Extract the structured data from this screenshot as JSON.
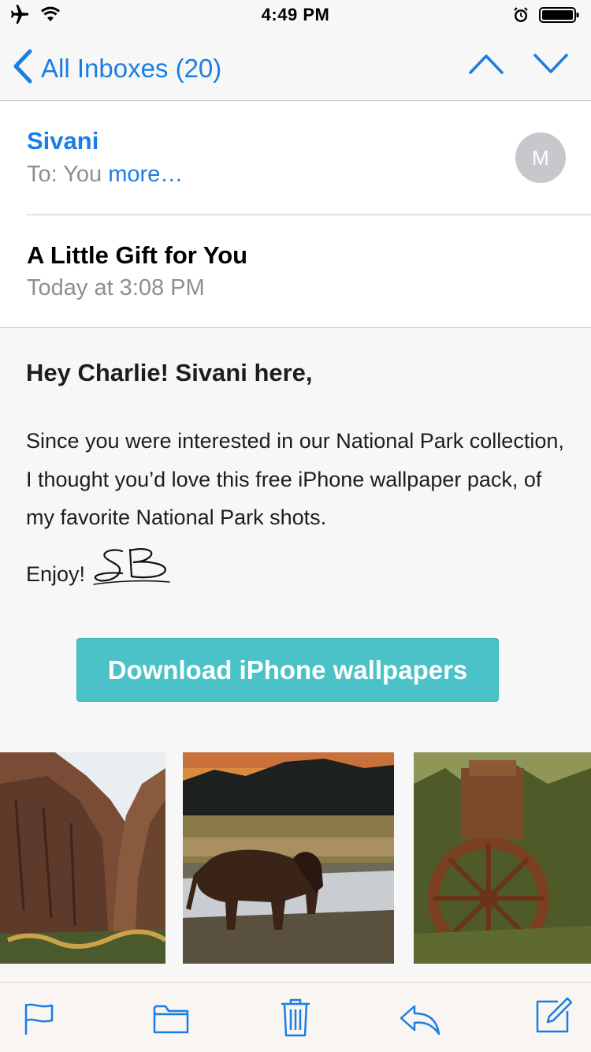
{
  "status_bar": {
    "time": "4:49 PM",
    "icons": [
      "airplane-icon",
      "wifi-icon",
      "alarm-icon",
      "battery-icon"
    ]
  },
  "nav": {
    "back_label": "All Inboxes (20)",
    "prev_icon": "chevron-up-icon",
    "next_icon": "chevron-down-icon"
  },
  "message": {
    "sender": "Sivani",
    "to_label": "To:",
    "to_value": "You",
    "more_label": "more…",
    "avatar_initial": "M",
    "subject": "A Little Gift for You",
    "date": "Today at 3:08 PM"
  },
  "body": {
    "greeting": "Hey Charlie! Sivani here,",
    "paragraph": "Since you were interested in our National Park collection, I thought you’d love this free iPhone wallpaper pack, of my favorite National Park shots.",
    "signoff": "Enjoy!",
    "signature_initials": "SB",
    "button_label": "Download iPhone wallpapers",
    "photos": [
      "canyon-photo",
      "bison-photo",
      "rusty-machine-photo"
    ]
  },
  "toolbar": {
    "items": [
      "flag-icon",
      "folder-icon",
      "trash-icon",
      "reply-icon",
      "compose-icon"
    ]
  },
  "colors": {
    "accent": "#1a7ee3",
    "button": "#4bc2c7",
    "secondary_text": "#8e8e93"
  }
}
